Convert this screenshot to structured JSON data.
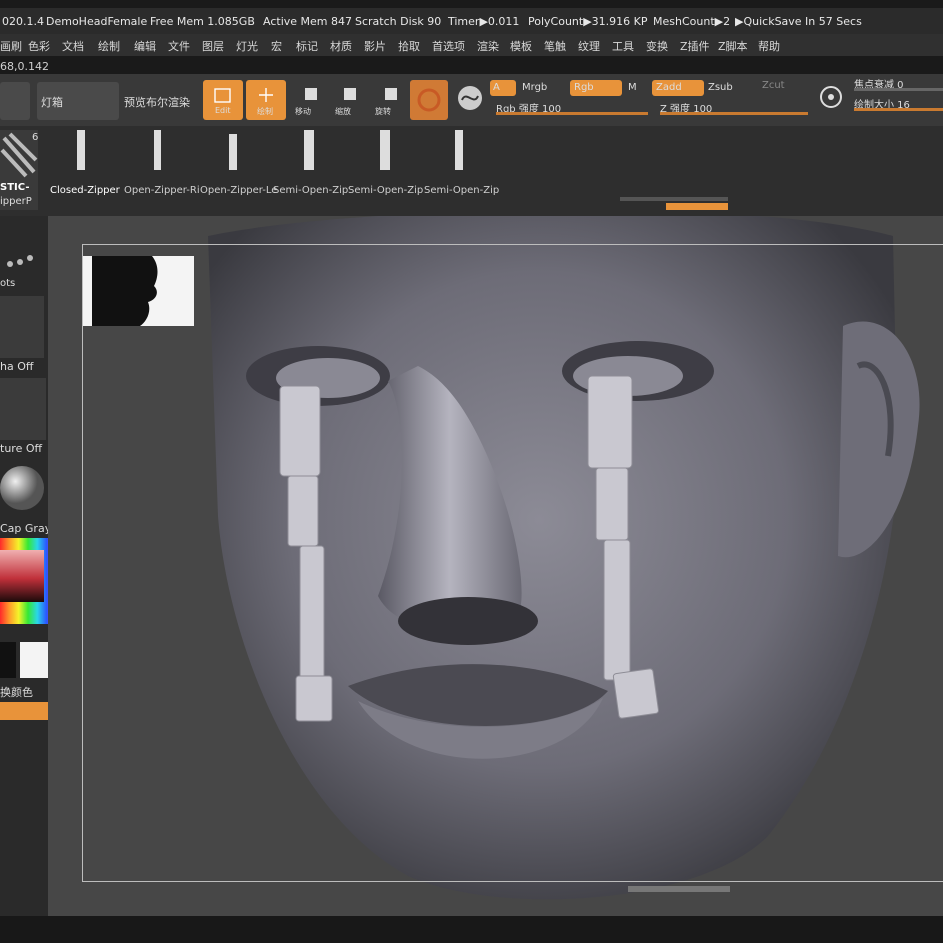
{
  "statusbar": {
    "version": "020.1.4",
    "document": "DemoHeadFemale",
    "free_mem": "Free Mem 1.085GB",
    "active_mem": "Active Mem 847",
    "scratch_disk": "Scratch Disk 90",
    "timer": "Timer▶0.011",
    "polycount": "PolyCount▶31.916 KP",
    "meshcount": "MeshCount▶2",
    "quicksave": "▶QuickSave In 57 Secs"
  },
  "menubar": {
    "items": [
      "画刷",
      "色彩",
      "文档",
      "绘制",
      "编辑",
      "文件",
      "图层",
      "灯光",
      "宏",
      "标记",
      "材质",
      "影片",
      "拾取",
      "首选项",
      "渲染",
      "模板",
      "笔触",
      "纹理",
      "工具",
      "变换",
      "Z插件",
      "Z脚本",
      "帮助"
    ]
  },
  "coords": "68,0.142",
  "toolbar": {
    "lightbox": "灯箱",
    "preview_render": "预览布尔渲染",
    "edit_label": "Edit",
    "draw_label": "绘制",
    "move_label": "移动",
    "scale_label": "缩放",
    "rotate_label": "旋转",
    "a_label": "A",
    "mrgb": "Mrgb",
    "rgb": "Rgb",
    "m": "M",
    "zadd": "Zadd",
    "zsub": "Zsub",
    "zcut": "Zcut",
    "rgb_intensity": "Rgb 强度 100",
    "z_intensity": "Z 强度 100",
    "focal_shift": "焦点衰减 0",
    "draw_size": "绘制大小 16"
  },
  "brushes": {
    "current_label_top": "STIC-",
    "current_label_bottom": "ipperP",
    "count": "6",
    "items": [
      "Closed-Zipper",
      "Open-Zipper-Ri",
      "Open-Zipper-Le",
      "Semi-Open-Zip",
      "Semi-Open-Zip",
      "Semi-Open-Zip"
    ]
  },
  "leftpanel": {
    "dots_label": "ots",
    "alpha_off": "ha Off",
    "texture_off": "ture Off",
    "material": "Cap Gray",
    "swap_color": "换颜色"
  }
}
